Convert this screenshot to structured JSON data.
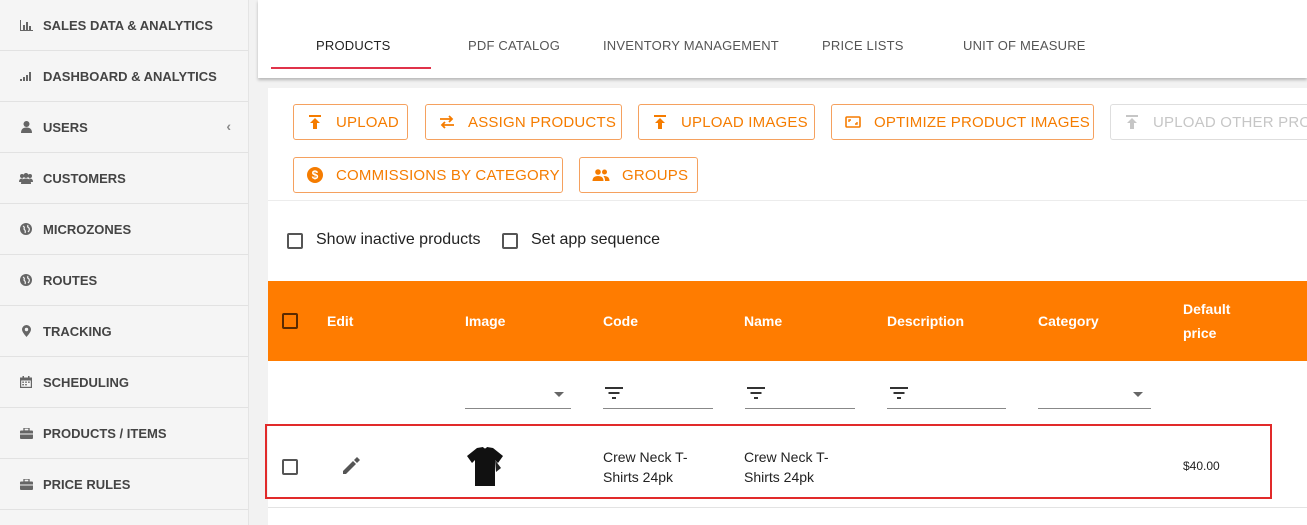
{
  "sidebar": {
    "items": [
      {
        "label": "SALES DATA & ANALYTICS",
        "icon": "bar-chart-icon"
      },
      {
        "label": "DASHBOARD & ANALYTICS",
        "icon": "signal-bars-icon"
      },
      {
        "label": "USERS",
        "icon": "user-icon",
        "chevron": "‹"
      },
      {
        "label": "CUSTOMERS",
        "icon": "users-group-icon"
      },
      {
        "label": "MICROZONES",
        "icon": "globe-icon"
      },
      {
        "label": "ROUTES",
        "icon": "globe-icon"
      },
      {
        "label": "TRACKING",
        "icon": "map-pin-icon"
      },
      {
        "label": "SCHEDULING",
        "icon": "calendar-icon"
      },
      {
        "label": "PRODUCTS / ITEMS",
        "icon": "briefcase-icon"
      },
      {
        "label": "PRICE RULES",
        "icon": "briefcase-icon"
      }
    ]
  },
  "tabs": [
    "PRODUCTS",
    "PDF CATALOG",
    "INVENTORY MANAGEMENT",
    "PRICE LISTS",
    "UNIT OF MEASURE"
  ],
  "toolbar": {
    "upload": "UPLOAD",
    "assign_products": "ASSIGN PRODUCTS",
    "upload_images": "UPLOAD IMAGES",
    "optimize_images": "OPTIMIZE PRODUCT IMAGES",
    "upload_other": "UPLOAD OTHER PROD",
    "commissions": "COMMISSIONS BY CATEGORY",
    "groups": "GROUPS"
  },
  "options": {
    "show_inactive": "Show inactive products",
    "set_sequence": "Set app sequence"
  },
  "table": {
    "headers": {
      "edit": "Edit",
      "image": "Image",
      "code": "Code",
      "name": "Name",
      "description": "Description",
      "category": "Category",
      "default_price_1": "Default",
      "default_price_2": "price"
    },
    "rows": [
      {
        "code_1": "Crew Neck T-",
        "code_2": "Shirts 24pk",
        "name_1": "Crew Neck T-",
        "name_2": "Shirts 24pk",
        "description": "",
        "category": "",
        "price": "$40.00"
      }
    ]
  },
  "colors": {
    "accent": "#ff7c00",
    "tab_indicator": "#e0334a",
    "highlight": "#e12a2a"
  }
}
